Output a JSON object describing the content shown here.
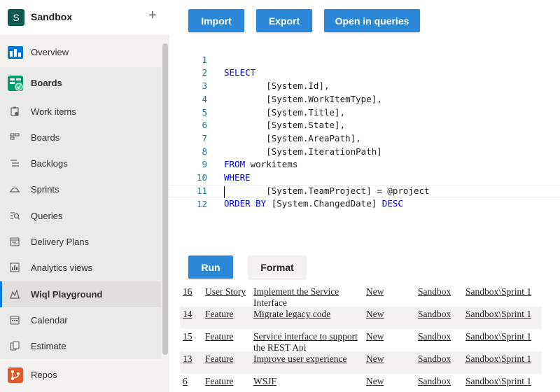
{
  "project": {
    "avatar_letter": "S",
    "name": "Sandbox",
    "add_label": "+"
  },
  "nav": {
    "overview": "Overview",
    "boards_hub": "Boards",
    "work_items": "Work items",
    "boards": "Boards",
    "backlogs": "Backlogs",
    "sprints": "Sprints",
    "queries": "Queries",
    "delivery_plans": "Delivery Plans",
    "analytics_views": "Analytics views",
    "wiql_playground": "Wiql Playground",
    "calendar": "Calendar",
    "estimate": "Estimate",
    "repos": "Repos"
  },
  "toolbar": {
    "import": "Import",
    "export": "Export",
    "open_in_queries": "Open in queries"
  },
  "editor": {
    "lines": [
      {
        "n": "1",
        "kw": "SELECT",
        "rest": ""
      },
      {
        "n": "2",
        "kw": "",
        "rest": "        [System.Id],"
      },
      {
        "n": "3",
        "kw": "",
        "rest": "        [System.WorkItemType],"
      },
      {
        "n": "4",
        "kw": "",
        "rest": "        [System.Title],"
      },
      {
        "n": "5",
        "kw": "",
        "rest": "        [System.State],"
      },
      {
        "n": "6",
        "kw": "",
        "rest": "        [System.AreaPath],"
      },
      {
        "n": "7",
        "kw": "",
        "rest": "        [System.IterationPath]"
      },
      {
        "n": "8",
        "kw": "FROM",
        "rest": " workitems"
      },
      {
        "n": "9",
        "kw": "WHERE",
        "rest": ""
      },
      {
        "n": "10",
        "kw": "",
        "rest": "        [System.TeamProject] = @project"
      },
      {
        "n": "11",
        "kw": "ORDER BY",
        "rest": " [System.ChangedDate] ",
        "kw2": "DESC"
      },
      {
        "n": "12",
        "kw": "",
        "rest": ""
      }
    ]
  },
  "actions": {
    "run": "Run",
    "format": "Format"
  },
  "results": {
    "rows": [
      {
        "id": "16",
        "type": "User Story",
        "title": "Implement the Service Interface",
        "state": "New",
        "area": "Sandbox",
        "iteration": "Sandbox\\Sprint 1"
      },
      {
        "id": "14",
        "type": "Feature",
        "title": "Migrate legacy code",
        "state": "New",
        "area": "Sandbox",
        "iteration": "Sandbox\\Sprint 1"
      },
      {
        "id": "15",
        "type": "Feature",
        "title": "Service interface to support the REST Api",
        "state": "New",
        "area": "Sandbox",
        "iteration": "Sandbox\\Sprint 1"
      },
      {
        "id": "13",
        "type": "Feature",
        "title": "Improve user experience",
        "state": "New",
        "area": "Sandbox",
        "iteration": "Sandbox\\Sprint 1"
      },
      {
        "id": "6",
        "type": "Feature",
        "title": "WSJF",
        "state": "New",
        "area": "Sandbox",
        "iteration": "Sandbox\\Sprint 1"
      }
    ]
  },
  "colors": {
    "accent": "#2b88d8",
    "keyword": "#0000ff",
    "line_number": "#237893",
    "active_bar": "#0078d4"
  }
}
